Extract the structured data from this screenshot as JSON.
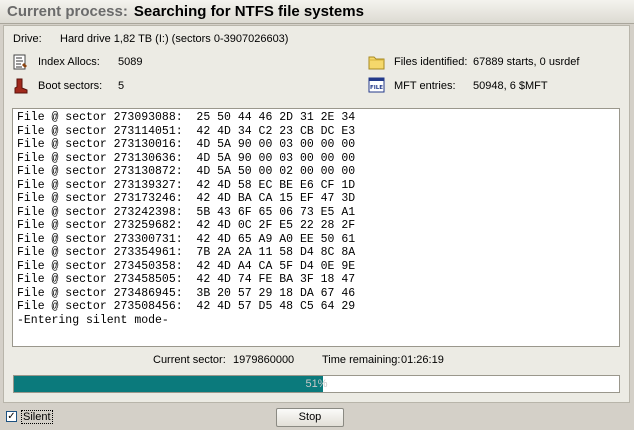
{
  "title": {
    "label": "Current process:",
    "value": "Searching for NTFS file systems"
  },
  "drive": {
    "label": "Drive:",
    "value": "Hard drive 1,82 TB (I:) (sectors 0-3907026603)"
  },
  "stats": {
    "index_allocs": {
      "label": "Index Allocs:",
      "value": "5089",
      "icon": "index-allocs-icon"
    },
    "boot_sectors": {
      "label": "Boot sectors:",
      "value": "5",
      "icon": "boot-icon"
    },
    "files_identified": {
      "label": "Files identified:",
      "value": "67889 starts, 0 usrdef",
      "icon": "folder-icon"
    },
    "mft_entries": {
      "label": "MFT entries:",
      "value": "50948, 6 $MFT",
      "icon": "mft-file-icon",
      "icon_text": "FILE"
    }
  },
  "log": {
    "lines": [
      "File @ sector 273093088:  25 50 44 46 2D 31 2E 34",
      "File @ sector 273114051:  42 4D 34 C2 23 CB DC E3",
      "File @ sector 273130016:  4D 5A 90 00 03 00 00 00",
      "File @ sector 273130636:  4D 5A 90 00 03 00 00 00",
      "File @ sector 273130872:  4D 5A 50 00 02 00 00 00",
      "File @ sector 273139327:  42 4D 58 EC BE E6 CF 1D",
      "File @ sector 273173246:  42 4D BA CA 15 EF 47 3D",
      "File @ sector 273242398:  5B 43 6F 65 06 73 E5 A1",
      "File @ sector 273259682:  42 4D 0C 2F E5 22 28 2F",
      "File @ sector 273300731:  42 4D 65 A9 A0 EE 50 61",
      "File @ sector 273354961:  7B 2A 2A 11 58 D4 8C 8A",
      "File @ sector 273450358:  42 4D A4 CA 5F D4 0E 9E",
      "File @ sector 273458505:  42 4D 74 FE BA 3F 18 47",
      "File @ sector 273486945:  3B 20 57 29 18 DA 67 46",
      "File @ sector 273508456:  42 4D 57 D5 48 C5 64 29",
      "-Entering silent mode-"
    ]
  },
  "status": {
    "current_sector_label": "Current sector:",
    "current_sector_value": "1979860000",
    "time_remaining_label": "Time remaining:",
    "time_remaining_value": "01:26:19"
  },
  "progress": {
    "percent": 51,
    "label": "51%",
    "color": "#0b7a7c"
  },
  "bottom": {
    "silent_label": "Silent",
    "silent_checked": true,
    "check_mark": "✓",
    "stop_label": "Stop"
  }
}
